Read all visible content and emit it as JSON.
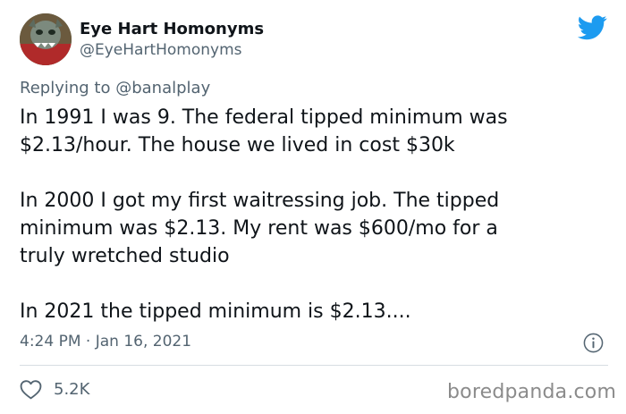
{
  "tweet": {
    "author_name": "Eye Hart Homonyms",
    "author_handle": "@EyeHartHomonyms",
    "replying_label": "Replying to",
    "replying_handle": "@banalplay",
    "paragraphs": [
      "In 1991 I was 9.  The federal tipped minimum was\n$2.13/hour.  The house we lived in cost $30k",
      "In 2000 I got my first waitressing job.  The tipped\nminimum was $2.13.  My rent was $600/mo for a\ntruly wretched studio",
      "In 2021 the tipped minimum is $2.13...."
    ],
    "timestamp": "4:24 PM · Jan 16, 2021",
    "likes": "5.2K"
  },
  "watermark": "boredpanda.com",
  "icons": {
    "brand": "twitter-bird-icon",
    "info": "info-icon",
    "like": "heart-icon"
  },
  "colors": {
    "twitter_blue": "#1d9bf0",
    "text": "#0f1419",
    "secondary_text": "#536471",
    "divider": "#d7dde2",
    "watermark": "#8b8b8b"
  }
}
